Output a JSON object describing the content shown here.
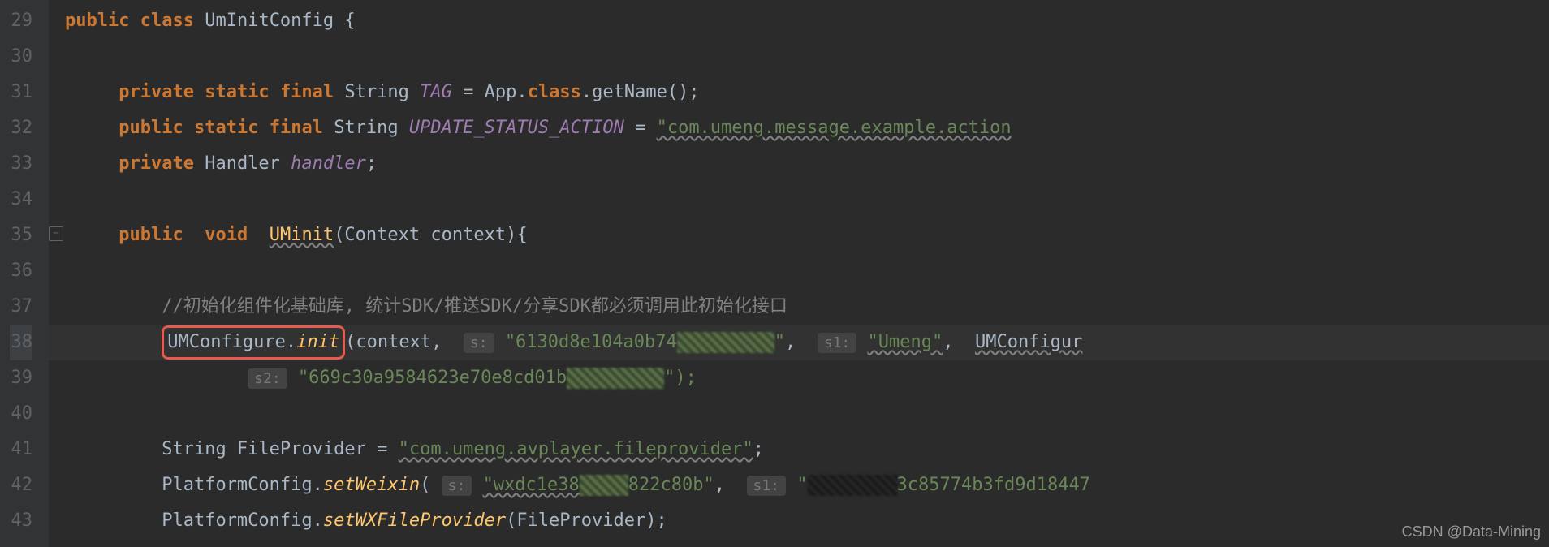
{
  "gutter": {
    "lines": [
      "29",
      "30",
      "31",
      "32",
      "33",
      "34",
      "35",
      "36",
      "37",
      "38",
      "39",
      "40",
      "41",
      "42",
      "43"
    ]
  },
  "code": {
    "l29": {
      "public": "public",
      "class": "class",
      "name": "UmInitConfig",
      "brace": " {"
    },
    "l31": {
      "private": "private",
      "static": "static",
      "final": "final",
      "type": "String",
      "field": "TAG",
      "eq": " = App.",
      "class_kw": "class",
      "getName": ".getName();"
    },
    "l32": {
      "public": "public",
      "static": "static",
      "final": "final",
      "type": "String",
      "field": "UPDATE_STATUS_ACTION",
      "eq": " = ",
      "str": "\"com.umeng.message.example.action"
    },
    "l33": {
      "private": "private",
      "type": "Handler",
      "field": "handler",
      "semi": ";"
    },
    "l35": {
      "public": "public",
      "void": "void",
      "method": "UMinit",
      "params": "(Context context){"
    },
    "l37": {
      "comment": "//初始化组件化基础库, 统计SDK/推送SDK/分享SDK都必须调用此初始化接口"
    },
    "l38": {
      "cls": "UMConfigure",
      "dot": ".",
      "init": "init",
      "open": "(context,",
      "hint_s": "s:",
      "str1": "\"6130d8e104a0b74",
      "str1end": "\"",
      "comma": ",",
      "hint_s1": "s1:",
      "str2": "\"Umeng\"",
      "comma2": ",",
      "cls2": "UMConfigur"
    },
    "l39": {
      "hint_s2": "s2:",
      "str": "\"669c30a9584623e70e8cd01b",
      "end": "\");"
    },
    "l41": {
      "type": "String FileProvider = ",
      "str": "\"com.umeng.avplayer.fileprovider\"",
      "semi": ";"
    },
    "l42": {
      "cls": "PlatformConfig.",
      "method": "setWeixin",
      "open": "(",
      "hint_s": "s:",
      "str1": "\"wxdc1e38",
      "str1mid": "822c80b\"",
      "comma": ",",
      "hint_s1": "s1:",
      "quote": "\"",
      "str2": "3c85774b3fd9d18447"
    },
    "l43": {
      "cls": "PlatformConfig.",
      "method": "setWXFileProvider",
      "params": "(FileProvider);"
    }
  },
  "watermark": "CSDN @Data-Mining",
  "fold_icon": "−"
}
